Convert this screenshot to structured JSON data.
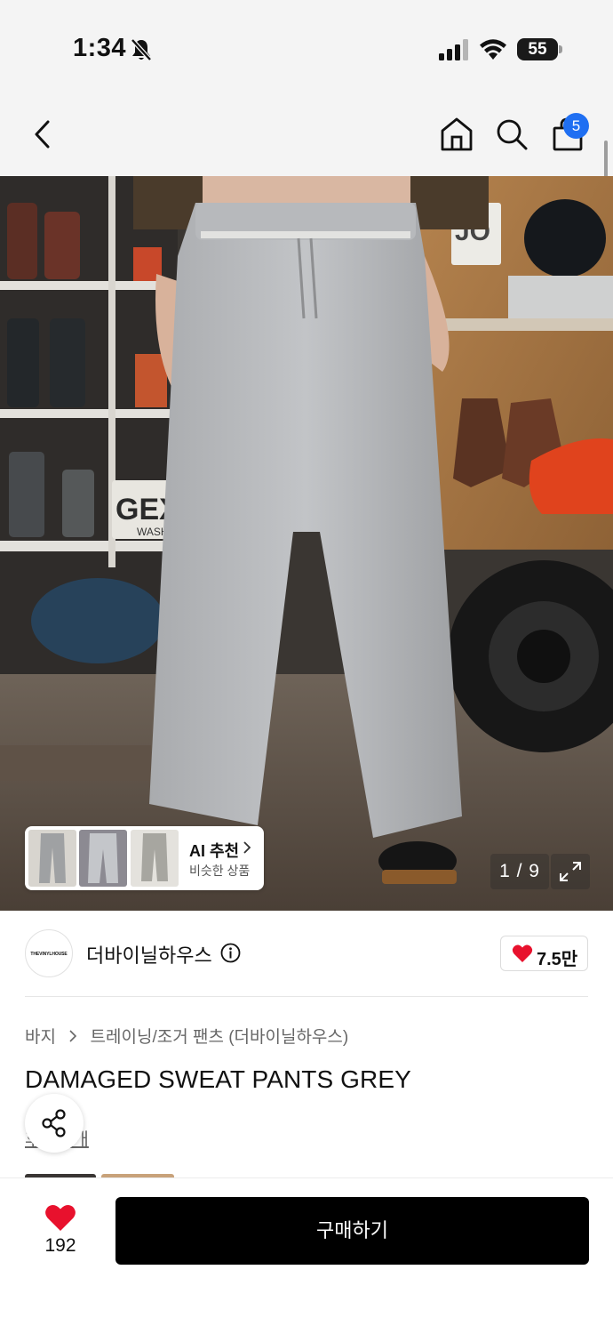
{
  "status_bar": {
    "time": "1:34",
    "battery": "55"
  },
  "nav": {
    "cart_count": "5"
  },
  "hero": {
    "license_plate_text": "GEX",
    "license_plate_sub": "WASH",
    "sign_text": "JO"
  },
  "ai_recommend": {
    "title": "AI 추천",
    "subtitle": "비슷한 상품"
  },
  "gallery": {
    "page_indicator": "1 / 9"
  },
  "brand": {
    "logo_text": "THEVINYLHOUSE",
    "name": "더바이닐하우스",
    "like_count": "7.5만"
  },
  "breadcrumb": {
    "items": [
      "바지",
      "트레이닝/조거 팬츠 (더바이닐하우스)"
    ]
  },
  "product": {
    "title": "DAMAGED SWEAT PANTS GREY",
    "review_text": "후기 1개"
  },
  "bottom_bar": {
    "wish_count": "192",
    "buy_label": "구매하기"
  },
  "colors": {
    "accent_blue": "#1f6ff2",
    "heart_red": "#e8112d",
    "buy_black": "#000000"
  },
  "icons": [
    "bell-slash-icon",
    "signal-icon",
    "wifi-icon",
    "back-icon",
    "home-icon",
    "search-icon",
    "shopping-bag-icon",
    "info-icon",
    "heart-icon",
    "share-icon",
    "expand-icon",
    "chevron-right-icon"
  ]
}
